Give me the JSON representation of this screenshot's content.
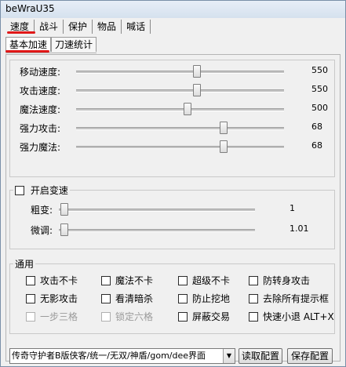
{
  "window": {
    "title": "beWraU35"
  },
  "tabs": [
    {
      "label": "速度"
    },
    {
      "label": "战斗"
    },
    {
      "label": "保护"
    },
    {
      "label": "物品"
    },
    {
      "label": "喊话"
    }
  ],
  "subtabs": [
    {
      "label": "基本加速"
    },
    {
      "label": "刀速统计"
    }
  ],
  "speed": {
    "rows": [
      {
        "label": "移动速度:",
        "value": "550",
        "level": 0.55
      },
      {
        "label": "攻击速度:",
        "value": "550",
        "level": 0.55
      },
      {
        "label": "魔法速度:",
        "value": "500",
        "level": 0.5
      },
      {
        "label": "强力攻击:",
        "value": "68",
        "level": 0.68
      },
      {
        "label": "强力魔法:",
        "value": "68",
        "level": 0.68
      }
    ]
  },
  "variable_speed": {
    "enable_label": "开启变速",
    "coarse": {
      "label": "粗变:",
      "value": "1",
      "level": 0.0
    },
    "fine": {
      "label": "微调:",
      "value": "1.01",
      "level": 0.0
    }
  },
  "general": {
    "legend": "通用",
    "options": [
      {
        "label": "攻击不卡",
        "disabled": false
      },
      {
        "label": "魔法不卡",
        "disabled": false
      },
      {
        "label": "超级不卡",
        "disabled": false
      },
      {
        "label": "防转身攻击",
        "disabled": false
      },
      {
        "label": "无影攻击",
        "disabled": false
      },
      {
        "label": "看清暗杀",
        "disabled": false
      },
      {
        "label": "防止挖地",
        "disabled": false
      },
      {
        "label": "去除所有提示框",
        "disabled": false
      },
      {
        "label": "一步三格",
        "disabled": true
      },
      {
        "label": "锁定六格",
        "disabled": true
      },
      {
        "label": "屏蔽交易",
        "disabled": false
      },
      {
        "label": "快速小退 ALT+X",
        "disabled": false
      }
    ]
  },
  "footer": {
    "profile_select": "传奇守护者B版侠客/统一/无双/神盾/gom/dee界面",
    "load_button": "读取配置",
    "save_button": "保存配置"
  },
  "colors": {
    "annotation_red": "#e01818"
  }
}
